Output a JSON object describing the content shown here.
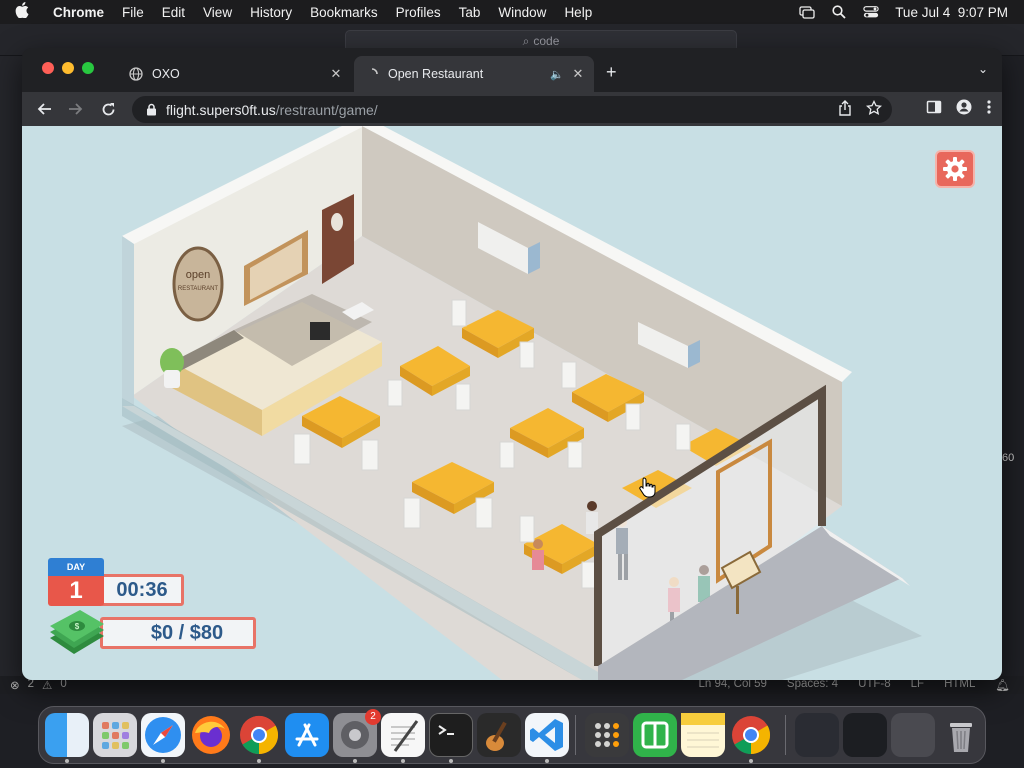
{
  "menubar": {
    "app_name": "Chrome",
    "items": [
      "File",
      "Edit",
      "View",
      "History",
      "Bookmarks",
      "Profiles",
      "Tab",
      "Window",
      "Help"
    ],
    "clock": "Tue Jul 4  9:07 PM"
  },
  "vscode": {
    "search_text": "code",
    "side_number": "60",
    "status_left": {
      "errors": "2",
      "warnings": "0"
    },
    "status_right": [
      "Ln 94, Col 59",
      "Spaces: 4",
      "UTF-8",
      "LF",
      "HTML"
    ]
  },
  "browser": {
    "tabs": [
      {
        "title": "OXO",
        "close": "✕"
      },
      {
        "title": "Open Restaurant",
        "close": "✕",
        "audio": "🔈"
      }
    ],
    "new_tab": "+",
    "tab_menu": "⌄",
    "url_host": "flight.supers0ft.us",
    "url_path": "/restraunt/game/"
  },
  "game": {
    "sign_line1": "open",
    "sign_line2": "RESTAURANT",
    "day_label": "DAY",
    "day_number": "1",
    "timer": "00:36",
    "money": "$0 / $80",
    "colors": {
      "accent": "#e8685c",
      "table_top": "#f5b731",
      "wall": "#ece9e1",
      "floor": "#dcdcdc"
    }
  },
  "dock": {
    "apps": [
      "Finder",
      "Launchpad",
      "Safari",
      "Firefox",
      "Chrome",
      "App Store",
      "System Settings",
      "TextEdit",
      "Terminal",
      "GarageBand",
      "Visual Studio Code",
      "Calculator",
      "Numbers",
      "Notes",
      "Chrome"
    ],
    "settings_badge": "2"
  }
}
